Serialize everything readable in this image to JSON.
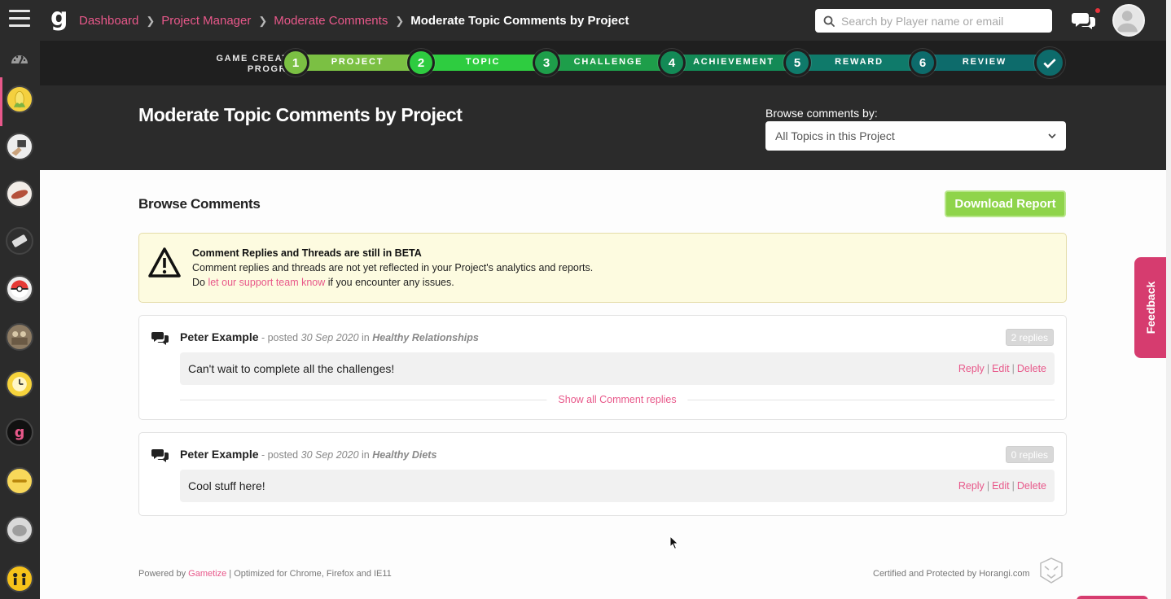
{
  "topbar": {
    "breadcrumb": [
      "Dashboard",
      "Project Manager",
      "Moderate Comments"
    ],
    "breadcrumb_current": "Moderate Topic Comments by Project",
    "search_placeholder": "Search by Player name or email",
    "icons": [
      "menu-icon",
      "gametize-logo",
      "search-icon",
      "chat-icon",
      "avatar"
    ]
  },
  "progress": {
    "label": "GAME CREATION PROGRESS",
    "steps": [
      {
        "number": "1",
        "label": "PROJECT",
        "color": "#7bc043"
      },
      {
        "number": "2",
        "label": "TOPIC",
        "color": "#2ecc40"
      },
      {
        "number": "3",
        "label": "CHALLENGE",
        "color": "#1e9e4a"
      },
      {
        "number": "4",
        "label": "ACHIEVEMENT",
        "color": "#138a56"
      },
      {
        "number": "5",
        "label": "REWARD",
        "color": "#0f7a6a"
      },
      {
        "number": "6",
        "label": "REVIEW",
        "color": "#0d6b6b"
      }
    ],
    "final_icon": "checkmark-icon"
  },
  "header": {
    "title": "Moderate Topic Comments by Project",
    "browse_label": "Browse comments by:",
    "browse_selected": "All Topics in this Project"
  },
  "main": {
    "heading": "Browse Comments",
    "download_label": "Download Report",
    "beta": {
      "title": "Comment Replies and Threads are still in BETA",
      "line1": "Comment replies and threads are not yet reflected in your Project's analytics and reports.",
      "line2_pre": "Do ",
      "line2_link": "let our support team know",
      "line2_post": " if you encounter any issues."
    },
    "comments": [
      {
        "author": "Peter Example",
        "posted": " - posted ",
        "date": "30 Sep 2020",
        "in": " in ",
        "topic": "Healthy Relationships",
        "replies": "2 replies",
        "text": "Can't wait to complete all the challenges!",
        "reply": "Reply",
        "edit": "Edit",
        "delete": "Delete",
        "show_all": "Show all Comment replies"
      },
      {
        "author": "Peter Example",
        "posted": " - posted ",
        "date": "30 Sep 2020",
        "in": " in ",
        "topic": "Healthy Diets",
        "replies": "0 replies",
        "text": "Cool stuff here!",
        "reply": "Reply",
        "edit": "Edit",
        "delete": "Delete"
      }
    ]
  },
  "footer": {
    "powered_pre": "Powered by ",
    "powered_link": "Gametize",
    "powered_post": " | Optimized for Chrome, Firefox and IE11",
    "certified": "Certified and Protected by Horangi.com"
  },
  "feedback_label": "Feedback",
  "colors": {
    "accent": "#e8588a",
    "download": "#8fd44b",
    "topbar": "#2b2b2b",
    "feedback": "#d63c6f"
  }
}
